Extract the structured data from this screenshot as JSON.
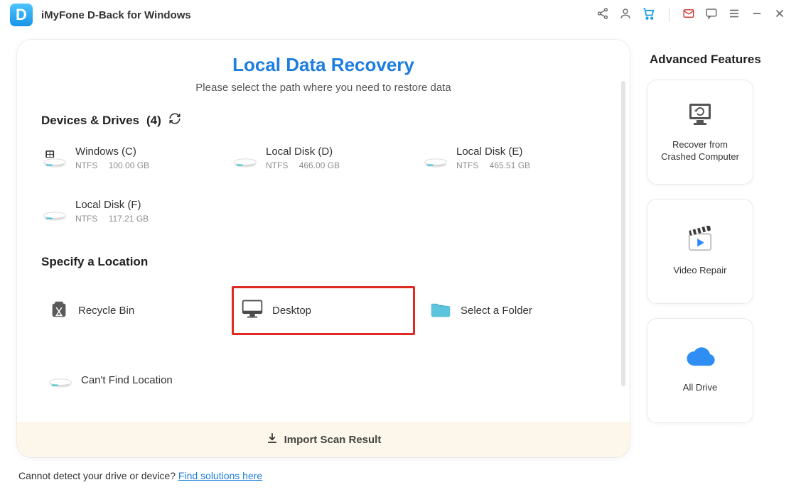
{
  "titlebar": {
    "app_name": "iMyFone D-Back for Windows",
    "logo_letter": "D"
  },
  "main": {
    "title": "Local Data Recovery",
    "subtitle": "Please select the path where you need to restore data",
    "devices_head_prefix": "Devices & Drives",
    "devices_count": "(4)",
    "drives": [
      {
        "name": "Windows (C)",
        "fs": "NTFS",
        "size": "100.00 GB",
        "os": true
      },
      {
        "name": "Local Disk (D)",
        "fs": "NTFS",
        "size": "466.00 GB"
      },
      {
        "name": "Local Disk (E)",
        "fs": "NTFS",
        "size": "465.51 GB"
      },
      {
        "name": "Local Disk (F)",
        "fs": "NTFS",
        "size": "117.21 GB"
      }
    ],
    "locations_head": "Specify a Location",
    "locations": [
      {
        "name": "Recycle Bin"
      },
      {
        "name": "Desktop"
      },
      {
        "name": "Select a Folder"
      },
      {
        "name": "Can't Find Location"
      }
    ],
    "import_label": "Import Scan Result"
  },
  "right": {
    "title": "Advanced Features",
    "cards": [
      {
        "label": "Recover from Crashed Computer"
      },
      {
        "label": "Video Repair"
      },
      {
        "label": "All Drive"
      }
    ]
  },
  "footer": {
    "text": "Cannot detect your drive or device? ",
    "link": "Find solutions here"
  }
}
